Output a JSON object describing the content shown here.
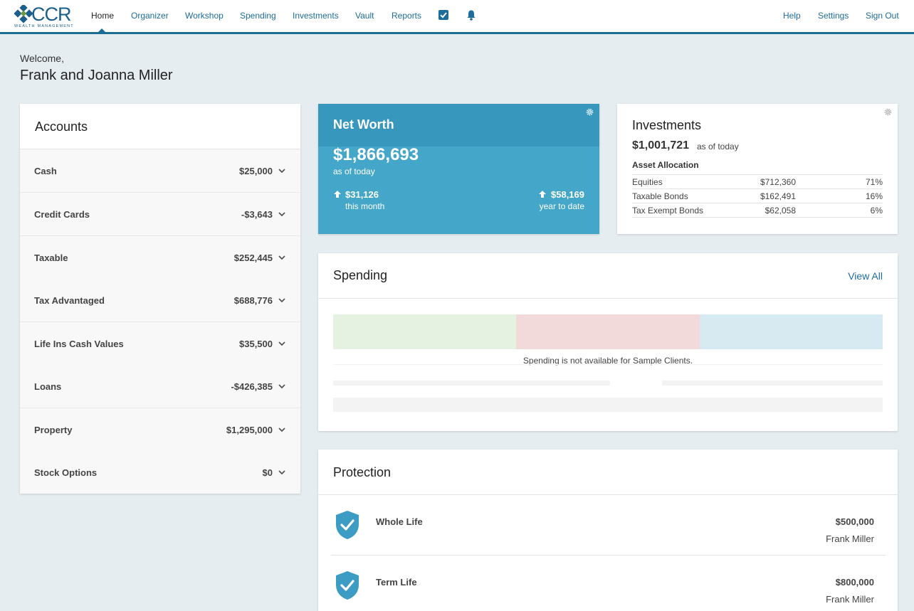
{
  "brand": {
    "name": "CCR",
    "tagline": "WEALTH MANAGEMENT",
    "accent": "#1b6d93"
  },
  "nav": {
    "items": [
      {
        "label": "Home"
      },
      {
        "label": "Organizer"
      },
      {
        "label": "Workshop"
      },
      {
        "label": "Spending"
      },
      {
        "label": "Investments"
      },
      {
        "label": "Vault"
      },
      {
        "label": "Reports"
      }
    ],
    "icons": [
      "checkbox-icon",
      "bell-icon"
    ],
    "right": [
      {
        "label": "Help"
      },
      {
        "label": "Settings"
      },
      {
        "label": "Sign Out"
      }
    ]
  },
  "welcome": {
    "greeting": "Welcome,",
    "name": "Frank and Joanna Miller"
  },
  "accounts": {
    "title": "Accounts",
    "rows": [
      {
        "label": "Cash",
        "value": "$25,000"
      },
      {
        "label": "Credit Cards",
        "value": "-$3,643"
      },
      {
        "label": "Taxable",
        "value": "$252,445"
      },
      {
        "label": "Tax Advantaged",
        "value": "$688,776"
      },
      {
        "label": "Life Ins Cash Values",
        "value": "$35,500"
      },
      {
        "label": "Loans",
        "value": "-$426,385"
      },
      {
        "label": "Property",
        "value": "$1,295,000"
      },
      {
        "label": "Stock Options",
        "value": "$0"
      }
    ]
  },
  "net_worth": {
    "title": "Net Worth",
    "amount": "$1,866,693",
    "as_of": "as of today",
    "month_change": "$31,126",
    "month_label": "this month",
    "ytd_change": "$58,169",
    "ytd_label": "year to date",
    "color": "#44a6c8"
  },
  "investments": {
    "title": "Investments",
    "amount": "$1,001,721",
    "as_of": "as of today",
    "allocation_title": "Asset Allocation",
    "rows": [
      {
        "name": "Equities",
        "value": "$712,360",
        "pct": "71%"
      },
      {
        "name": "Taxable Bonds",
        "value": "$162,491",
        "pct": "16%"
      },
      {
        "name": "Tax Exempt Bonds",
        "value": "$62,058",
        "pct": "6%"
      }
    ]
  },
  "spending": {
    "title": "Spending",
    "view_all": "View All",
    "note": "Spending is not available for Sample Clients.",
    "bar_colors": [
      "#e5f1e1",
      "#f2dada",
      "#d7e9f1"
    ]
  },
  "protection": {
    "title": "Protection",
    "items": [
      {
        "name": "Whole Life",
        "amount": "$500,000",
        "owner": "Frank Miller"
      },
      {
        "name": "Term Life",
        "amount": "$800,000",
        "owner": "Frank Miller"
      }
    ]
  }
}
